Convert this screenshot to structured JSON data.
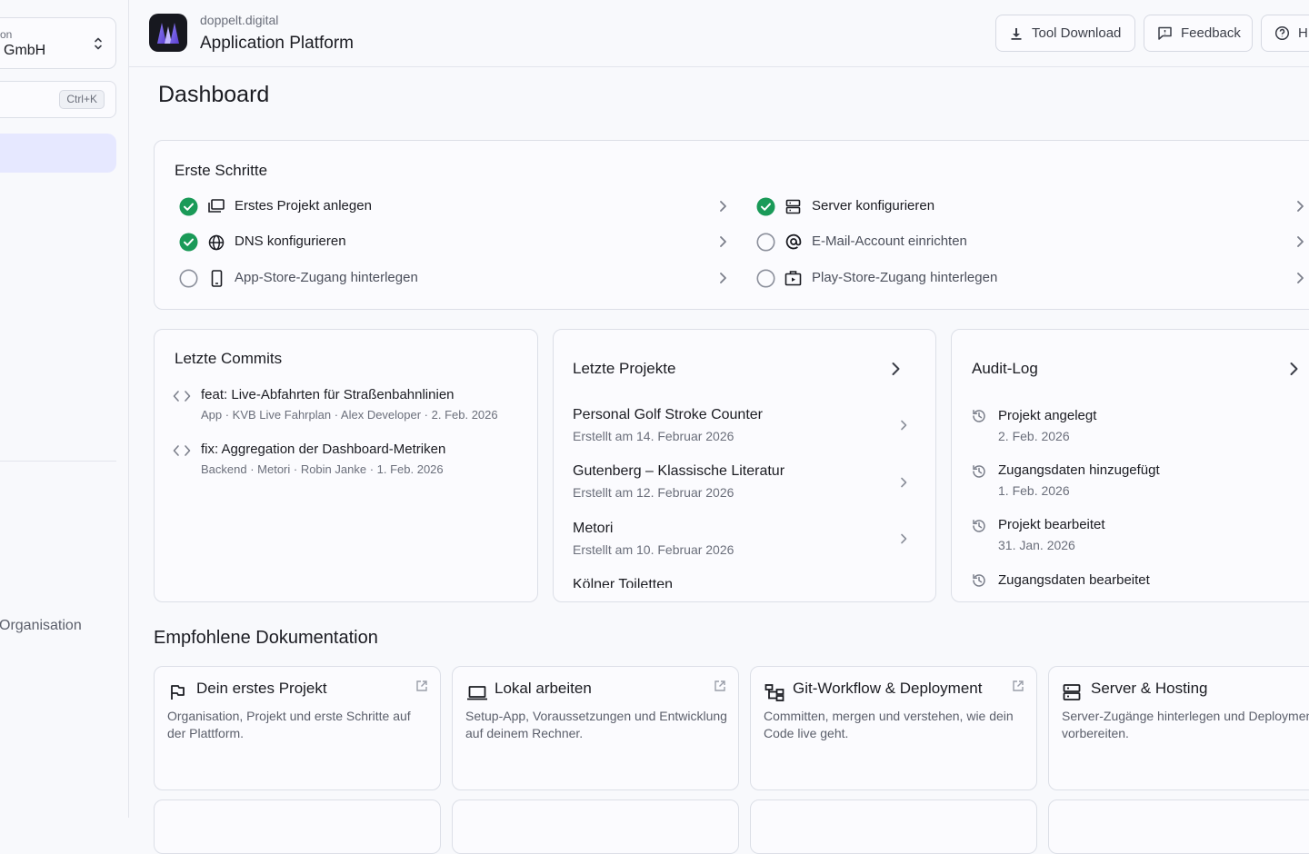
{
  "sidebar": {
    "org_label": "on",
    "org_name": "GmbH",
    "search_shortcut": "Ctrl+K",
    "bottom_item": "Organisation"
  },
  "header": {
    "brand_sub": "doppelt.digital",
    "brand_title": "Application Platform",
    "buttons": [
      {
        "label": "Tool Download",
        "icon": "download-icon"
      },
      {
        "label": "Feedback",
        "icon": "feedback-icon"
      },
      {
        "label": "H",
        "icon": "help-icon"
      }
    ]
  },
  "page_title": "Dashboard",
  "first_steps": {
    "title": "Erste Schritte",
    "items": [
      {
        "label": "Erstes Projekt anlegen",
        "done": true,
        "icon": "folders-icon"
      },
      {
        "label": "DNS konfigurieren",
        "done": true,
        "icon": "globe-icon"
      },
      {
        "label": "App-Store-Zugang hinterlegen",
        "done": false,
        "icon": "phone-icon"
      },
      {
        "label": "Server konfigurieren",
        "done": true,
        "icon": "server-icon"
      },
      {
        "label": "E-Mail-Account einrichten",
        "done": false,
        "icon": "at-icon"
      },
      {
        "label": "Play-Store-Zugang hinterlegen",
        "done": false,
        "icon": "store-icon"
      }
    ]
  },
  "commits": {
    "title": "Letzte Commits",
    "items": [
      {
        "title": "feat: Live-Abfahrten für Straßenbahnlinien",
        "meta": "App · KVB Live Fahrplan · Alex Developer · 2. Feb. 2026"
      },
      {
        "title": "fix: Aggregation der Dashboard-Metriken",
        "meta": "Backend · Metori · Robin Janke · 1. Feb. 2026"
      }
    ]
  },
  "projects": {
    "title": "Letzte Projekte",
    "items": [
      {
        "name": "Personal Golf Stroke Counter",
        "date": "Erstellt am 14. Februar 2026"
      },
      {
        "name": "Gutenberg – Klassische Literatur",
        "date": "Erstellt am 12. Februar 2026"
      },
      {
        "name": "Metori",
        "date": "Erstellt am 10. Februar 2026"
      },
      {
        "name": "Kölner Toiletten",
        "date": ""
      }
    ]
  },
  "audit": {
    "title": "Audit-Log",
    "items": [
      {
        "name": "Projekt angelegt",
        "date": "2. Feb. 2026"
      },
      {
        "name": "Zugangsdaten hinzugefügt",
        "date": "1. Feb. 2026"
      },
      {
        "name": "Projekt bearbeitet",
        "date": "31. Jan. 2026"
      },
      {
        "name": "Zugangsdaten bearbeitet",
        "date": ""
      }
    ]
  },
  "docs": {
    "heading": "Empfohlene Dokumentation",
    "items": [
      {
        "title": "Dein erstes Projekt",
        "desc": "Organisation, Projekt und erste Schritte auf der Plattform.",
        "icon": "flag-icon"
      },
      {
        "title": "Lokal arbeiten",
        "desc": "Setup-App, Voraussetzungen und Entwicklung auf deinem Rechner.",
        "icon": "laptop-icon"
      },
      {
        "title": "Git-Workflow & Deployment",
        "desc": "Committen, mergen und verstehen, wie dein Code live geht.",
        "icon": "workflow-icon"
      },
      {
        "title": "Server & Hosting",
        "desc": "Server-Zugänge hinterlegen und Deployments vorbereiten.",
        "icon": "server-icon"
      }
    ]
  },
  "colors": {
    "accent": "#6657d8",
    "success": "#1a9a58",
    "active_nav": "#e6e8ff"
  }
}
